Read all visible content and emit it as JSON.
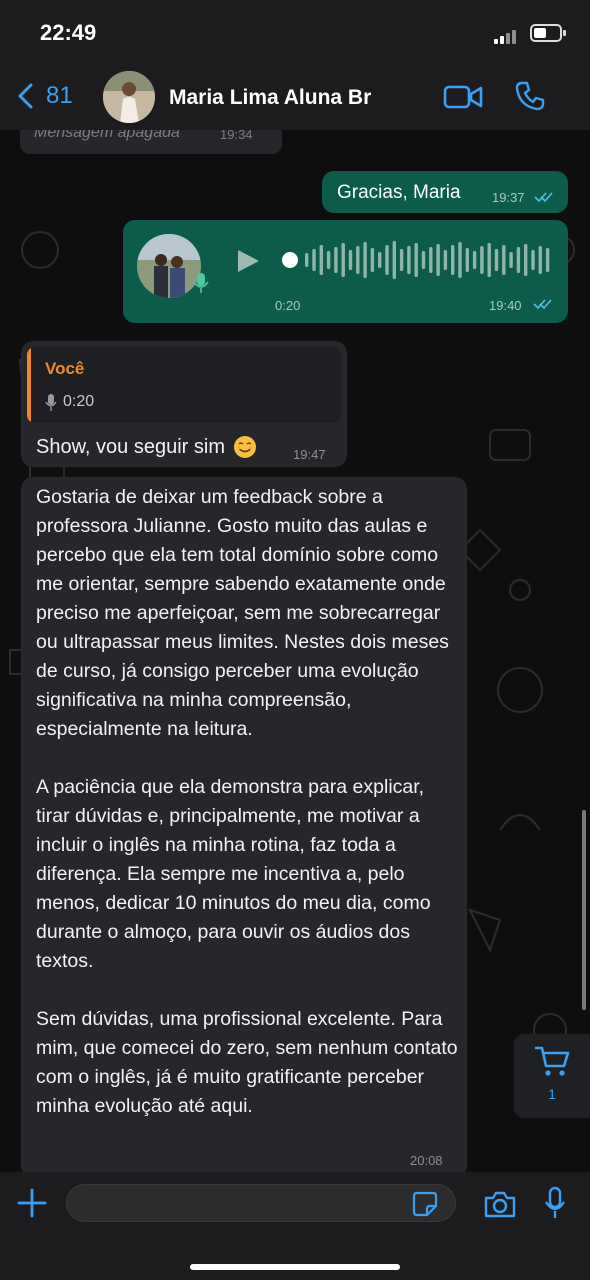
{
  "status_bar": {
    "time": "22:49"
  },
  "header": {
    "back_count": "81",
    "contact_name": "Maria Lima Aluna Br",
    "icons": [
      "back-chevron-icon",
      "video-call-icon",
      "phone-icon"
    ]
  },
  "messages": [
    {
      "type": "deleted",
      "direction": "in",
      "text": "Mensagem apagada",
      "time": "19:34"
    },
    {
      "type": "text",
      "direction": "out",
      "text": "Gracias, Maria",
      "time": "19:37",
      "read": true
    },
    {
      "type": "voice",
      "direction": "out",
      "duration": "0:20",
      "time": "19:40",
      "read": true
    },
    {
      "type": "reply",
      "direction": "in",
      "quote_author": "Você",
      "quote_duration": "0:20",
      "text": "Show, vou seguir sim",
      "emoji": "smiling-face-icon",
      "time": "19:47"
    },
    {
      "type": "text",
      "direction": "in",
      "text": "Gostaria de deixar um feedback sobre a professora Julianne. Gosto muito das aulas e percebo que ela tem total domínio sobre como me orientar, sempre sabendo exatamente onde preciso me aperfeiçoar, sem me sobrecarregar ou ultrapassar meus limites. Nestes dois meses de curso, já consigo perceber uma evolução significativa na minha compreensão, especialmente na leitura.\n\nA paciência que ela demonstra para explicar, tirar dúvidas e, principalmente, me motivar a incluir o inglês na minha rotina, faz toda a diferença. Ela sempre me incentiva a, pelo menos, dedicar 10 minutos do meu dia, como durante o almoço, para ouvir os áudios dos textos.\n\nSem dúvidas, uma profissional excelente. Para mim, que comecei do zero, sem nenhum contato com o inglês, já é muito gratificante perceber minha evolução até aqui.",
      "time": "20:08"
    }
  ],
  "cart": {
    "count": "1"
  },
  "composer": {
    "placeholder": "",
    "icons": [
      "plus-icon",
      "sticker-icon",
      "camera-icon",
      "microphone-icon"
    ]
  },
  "colors": {
    "accent": "#3aa0f3",
    "outgoing_bubble": "#0d5c4b",
    "incoming_bubble": "#26272b",
    "quote_accent": "#f08a28"
  }
}
